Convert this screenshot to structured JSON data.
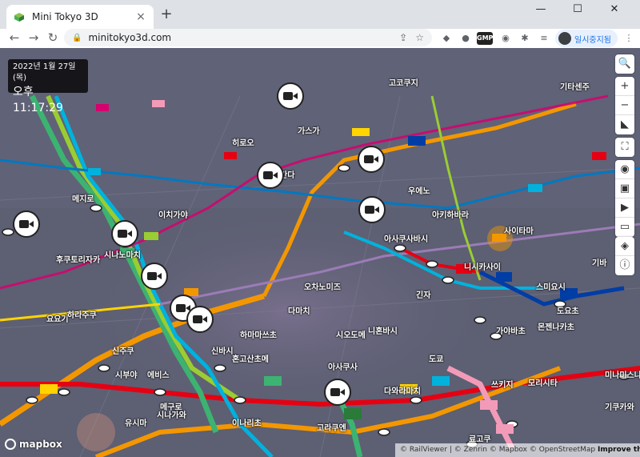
{
  "browser": {
    "tab_title": "Mini Tokyo 3D",
    "tab_close": "×",
    "new_tab": "+",
    "url": "minitokyo3d.com",
    "profile_name": "일시중지됨",
    "win_minimize": "—",
    "win_maximize": "☐",
    "win_close": "✕",
    "nav_back": "←",
    "nav_forward": "→",
    "nav_reload": "↻",
    "lock": "🔒",
    "share": "⇪",
    "star": "☆",
    "ext_labels": [
      "◆",
      "●",
      "GMP",
      "◉",
      "✱",
      "≡",
      "⋮"
    ]
  },
  "clock": {
    "date": "2022년 1월 27일 (목)",
    "time": "오후 11:17:29"
  },
  "controls": {
    "search": "🔍",
    "zoom_in": "+",
    "zoom_out": "−",
    "compass": "◣",
    "fullscreen": "⛶",
    "eye": "◉",
    "train": "▣",
    "play": "▶",
    "battery": "▭",
    "layers": "◈",
    "info": "ⓘ"
  },
  "map_labels": [
    "후쿠토리자카",
    "히로오",
    "가스가",
    "사이타마",
    "아사쿠사바시",
    "이치가야",
    "시나노마치",
    "메지로",
    "오차노미즈",
    "간다",
    "니혼바시",
    "기타센주",
    "고코쿠지",
    "아키하바라",
    "우에노",
    "요요기",
    "신주쿠",
    "하라주쿠",
    "시부야",
    "에비스",
    "메구로",
    "시나가와",
    "도쿄",
    "긴자",
    "신바시",
    "하마마쓰초",
    "다마치",
    "시오도메",
    "쓰키지",
    "가야바초",
    "몬젠나카초",
    "기바",
    "도요초",
    "미나미스나마치",
    "니시카사이",
    "스미요시",
    "기쿠카와",
    "모리시타",
    "료고쿠",
    "아사쿠사",
    "다와라마치",
    "이나리초",
    "유시마",
    "혼고산초메",
    "고라쿠엔"
  ],
  "mapbox_text": "mapbox",
  "attribution": {
    "rail": "© RailViewer",
    "zenrin": "© Zenrin",
    "mapbox": "© Mapbox",
    "osm": "© OpenStreetMap",
    "improve": "Improve this map"
  },
  "colors": {
    "map_bg": "#5f6074",
    "line_red": "#e60012",
    "line_orange": "#f39700",
    "line_yellow": "#ffd400",
    "line_green": "#3cb371",
    "line_lime": "#9acd32",
    "line_blue": "#0079c2",
    "line_sky": "#00b2dd",
    "line_navy": "#003da5",
    "line_pink": "#f29bb8",
    "line_purple": "#9b7cb6",
    "line_magenta": "#d7006e"
  }
}
